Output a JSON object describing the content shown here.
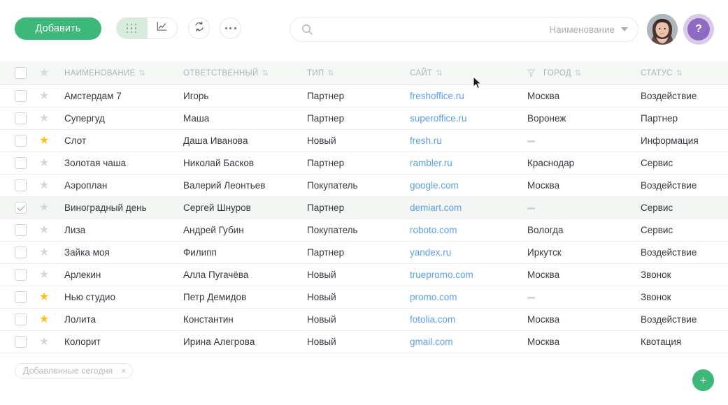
{
  "toolbar": {
    "add_label": "Добавить",
    "view_grid_icon": "grid-icon",
    "view_chart_icon": "chart-icon",
    "refresh_icon": "refresh-icon",
    "more_icon": "ellipsis-icon",
    "active_view": "grid"
  },
  "search": {
    "placeholder": "",
    "value": "",
    "icon": "search-icon",
    "filter_label": "Наименование",
    "caret_icon": "chevron-down-icon"
  },
  "account": {
    "avatar_icon": "avatar",
    "help_label": "?"
  },
  "table": {
    "columns": [
      {
        "key": "name",
        "label": "НАИМЕНОВАНИЕ",
        "sort_icon": "sort-icon"
      },
      {
        "key": "resp",
        "label": "ОТВЕТСТВЕННЫЙ",
        "sort_icon": "sort-icon"
      },
      {
        "key": "type",
        "label": "ТИП",
        "sort_icon": "sort-icon"
      },
      {
        "key": "site",
        "label": "САЙТ",
        "sort_icon": "sort-icon"
      },
      {
        "key": "city",
        "label": "ГОРОД",
        "sort_icon": "sort-icon",
        "filter_icon": "filter-icon"
      },
      {
        "key": "status",
        "label": "СТАТУС",
        "sort_icon": "sort-icon"
      }
    ],
    "rows": [
      {
        "name": "Амстердам 7",
        "resp": "Игорь",
        "type": "Партнер",
        "site": "freshoffice.ru",
        "city": "Москва",
        "status": "Воздействие",
        "starred": false,
        "checked": false,
        "selected": false
      },
      {
        "name": "Супергуд",
        "resp": "Маша",
        "type": "Партнер",
        "site": "superoffice.ru",
        "city": "Воронеж",
        "status": "Партнер",
        "starred": false,
        "checked": false,
        "selected": false
      },
      {
        "name": "Слот",
        "resp": "Даша Иванова",
        "type": "Новый",
        "site": "fresh.ru",
        "city": "",
        "status": "Информация",
        "starred": true,
        "checked": false,
        "selected": false
      },
      {
        "name": "Золотая чаша",
        "resp": "Николай Басков",
        "type": "Партнер",
        "site": "rambler.ru",
        "city": "Краснодар",
        "status": "Сервис",
        "starred": false,
        "checked": false,
        "selected": false
      },
      {
        "name": "Аэроплан",
        "resp": "Валерий Леонтьев",
        "type": "Покупатель",
        "site": "google.com",
        "city": "Москва",
        "status": "Воздействие",
        "starred": false,
        "checked": false,
        "selected": false
      },
      {
        "name": "Виноградный день",
        "resp": "Сергей Шнуров",
        "type": "Партнер",
        "site": "demiart.com",
        "city": "",
        "status": "Сервис",
        "starred": false,
        "checked": true,
        "selected": true
      },
      {
        "name": "Лиза",
        "resp": "Андрей Губин",
        "type": "Покупатель",
        "site": "roboto.com",
        "city": "Вологда",
        "status": "Сервис",
        "starred": false,
        "checked": false,
        "selected": false
      },
      {
        "name": "Зайка моя",
        "resp": "Филипп",
        "type": "Партнер",
        "site": "yandex.ru",
        "city": "Иркутск",
        "status": "Воздействие",
        "starred": false,
        "checked": false,
        "selected": false
      },
      {
        "name": "Арлекин",
        "resp": "Алла Пугачёва",
        "type": "Новый",
        "site": "truepromo.com",
        "city": "Москва",
        "status": "Звонок",
        "starred": false,
        "checked": false,
        "selected": false
      },
      {
        "name": "Нью студио",
        "resp": "Петр Демидов",
        "type": "Новый",
        "site": "promo.com",
        "city": "",
        "status": "Звонок",
        "starred": true,
        "checked": false,
        "selected": false
      },
      {
        "name": "Лолита",
        "resp": "Константин",
        "type": "Новый",
        "site": "fotolia.com",
        "city": "Москва",
        "status": "Воздействие",
        "starred": true,
        "checked": false,
        "selected": false
      },
      {
        "name": "Колорит",
        "resp": "Ирина Алегрова",
        "type": "Новый",
        "site": "gmail.com",
        "city": "Москва",
        "status": "Квотация",
        "starred": false,
        "checked": false,
        "selected": false
      }
    ]
  },
  "footer": {
    "filter_chip_label": "Добавленные сегодня",
    "filter_chip_close": "×",
    "fab_label": "+"
  },
  "colors": {
    "accent_green": "#3cb878",
    "active_view_bg": "#d7ecdd",
    "link_blue": "#5c9fea",
    "star_gold": "#fbc11c",
    "header_bg": "#f5f7f4",
    "selected_row_bg": "#f3f6f2",
    "help_purple": "#8d6bc4"
  }
}
